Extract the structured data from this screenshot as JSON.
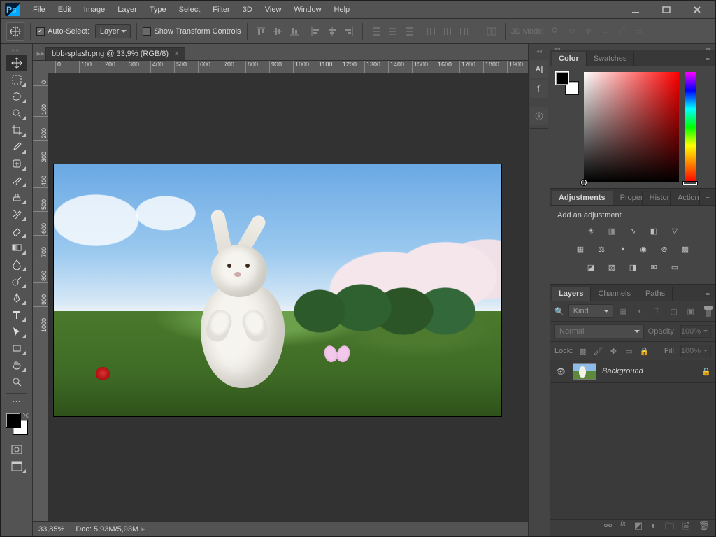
{
  "app": {
    "logo_text": "Ps"
  },
  "menu": [
    "File",
    "Edit",
    "Image",
    "Layer",
    "Type",
    "Select",
    "Filter",
    "3D",
    "View",
    "Window",
    "Help"
  ],
  "options": {
    "auto_select_label": "Auto-Select:",
    "auto_select_checked": true,
    "auto_select_scope": "Layer",
    "show_tc_label": "Show Transform Controls",
    "show_tc_checked": false,
    "mode3d_label": "3D Mode:"
  },
  "document": {
    "tab_title": "bbb-splash.png @ 33,9% (RGB/8)",
    "zoom_status": "33,85%",
    "doc_status": "Doc: 5,93M/5,93M"
  },
  "rulers": {
    "h": [
      "0",
      "100",
      "200",
      "300",
      "400",
      "500",
      "600",
      "700",
      "800",
      "900",
      "1000",
      "1100",
      "1200",
      "1300",
      "1400",
      "1500",
      "1600",
      "1700",
      "1800",
      "1900"
    ],
    "v": [
      "0",
      "100",
      "200",
      "300",
      "400",
      "500",
      "600",
      "700",
      "800",
      "900",
      "1000"
    ]
  },
  "tools": [
    {
      "name": "move-tool",
      "selected": true,
      "fly": false
    },
    {
      "name": "marquee-tool",
      "selected": false,
      "fly": true
    },
    {
      "name": "lasso-tool",
      "selected": false,
      "fly": true
    },
    {
      "name": "quick-select-tool",
      "selected": false,
      "fly": true
    },
    {
      "name": "crop-tool",
      "selected": false,
      "fly": true
    },
    {
      "name": "eyedropper-tool",
      "selected": false,
      "fly": true
    },
    {
      "name": "healing-brush-tool",
      "selected": false,
      "fly": true
    },
    {
      "name": "brush-tool",
      "selected": false,
      "fly": true
    },
    {
      "name": "clone-stamp-tool",
      "selected": false,
      "fly": true
    },
    {
      "name": "history-brush-tool",
      "selected": false,
      "fly": true
    },
    {
      "name": "eraser-tool",
      "selected": false,
      "fly": true
    },
    {
      "name": "gradient-tool",
      "selected": false,
      "fly": true
    },
    {
      "name": "blur-tool",
      "selected": false,
      "fly": true
    },
    {
      "name": "dodge-tool",
      "selected": false,
      "fly": true
    },
    {
      "name": "pen-tool",
      "selected": false,
      "fly": true
    },
    {
      "name": "type-tool",
      "selected": false,
      "fly": true
    },
    {
      "name": "path-select-tool",
      "selected": false,
      "fly": true
    },
    {
      "name": "shape-tool",
      "selected": false,
      "fly": true
    },
    {
      "name": "hand-tool",
      "selected": false,
      "fly": true
    },
    {
      "name": "zoom-tool",
      "selected": false,
      "fly": false
    }
  ],
  "color_panel": {
    "tabs": [
      "Color",
      "Swatches"
    ],
    "active_tab": 0,
    "foreground": "#000000",
    "background": "#ffffff",
    "hue_base": "#ff0000"
  },
  "adjustments_panel": {
    "tabs": [
      "Adjustments",
      "Properties",
      "History",
      "Actions"
    ],
    "active_tab": 0,
    "heading": "Add an adjustment",
    "row1": [
      "brightness-contrast",
      "levels",
      "curves",
      "exposure",
      "vibrance"
    ],
    "row2": [
      "hue-saturation",
      "color-balance",
      "black-white",
      "photo-filter",
      "channel-mixer",
      "color-lookup"
    ],
    "row3": [
      "invert",
      "posterize",
      "threshold",
      "selective-color",
      "gradient-map"
    ]
  },
  "layers_panel": {
    "tabs": [
      "Layers",
      "Channels",
      "Paths"
    ],
    "active_tab": 0,
    "filter_label": "Kind",
    "filter_icons": [
      "pixel",
      "adjustment",
      "type",
      "shape",
      "smartobject"
    ],
    "blend_mode": "Normal",
    "opacity_label": "Opacity:",
    "opacity_value": "100%",
    "lock_label": "Lock:",
    "lock_icons": [
      "pixels",
      "brush",
      "position",
      "artboard",
      "all"
    ],
    "fill_label": "Fill:",
    "fill_value": "100%",
    "layers": [
      {
        "visible": true,
        "name": "Background",
        "locked": true
      }
    ],
    "footer_icons": [
      "link",
      "fx",
      "mask",
      "adjustment",
      "group",
      "new",
      "delete"
    ]
  },
  "mid_tabs": {
    "group1": [
      "character-icon",
      "paragraph-icon"
    ],
    "group2": [
      "info-icon"
    ]
  }
}
